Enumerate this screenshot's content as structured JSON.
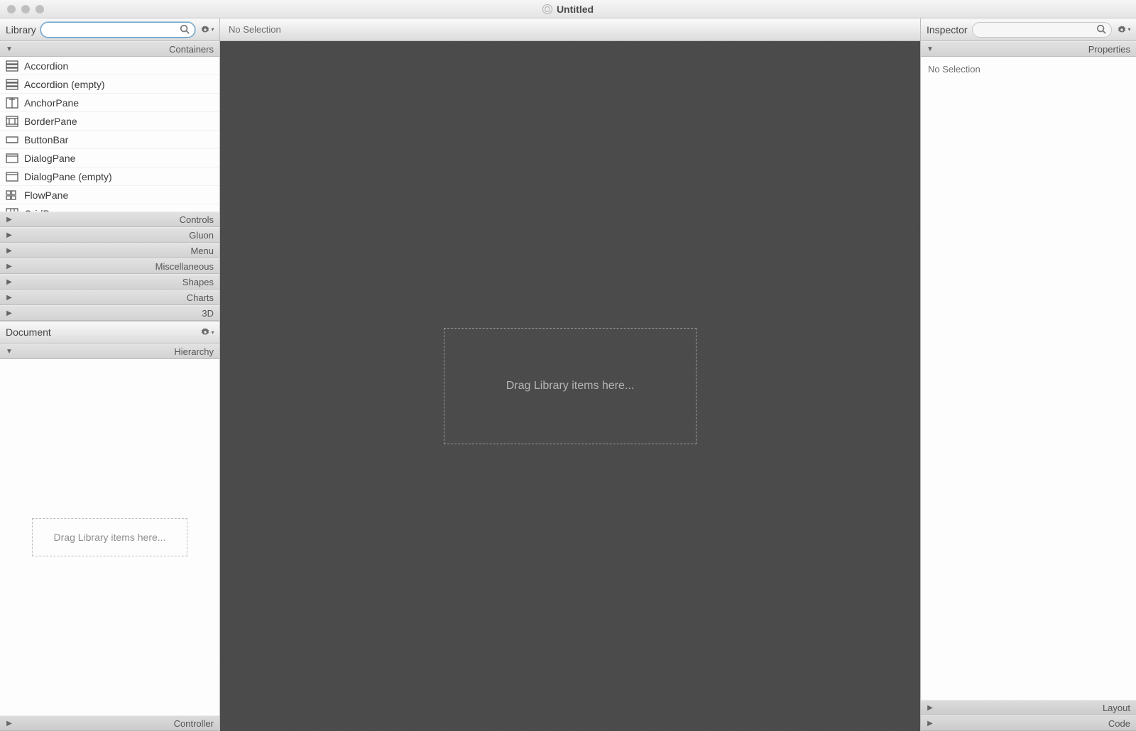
{
  "window": {
    "title": "Untitled"
  },
  "library": {
    "title": "Library",
    "search_value": "",
    "sections": {
      "containers": "Containers",
      "controls": "Controls",
      "gluon": "Gluon",
      "menu": "Menu",
      "miscellaneous": "Miscellaneous",
      "shapes": "Shapes",
      "charts": "Charts",
      "threeD": "3D"
    },
    "containers_items": [
      {
        "label": "Accordion",
        "icon": "accordion"
      },
      {
        "label": "Accordion  (empty)",
        "icon": "accordion"
      },
      {
        "label": "AnchorPane",
        "icon": "anchorpane"
      },
      {
        "label": "BorderPane",
        "icon": "borderpane"
      },
      {
        "label": "ButtonBar",
        "icon": "buttonbar"
      },
      {
        "label": "DialogPane",
        "icon": "dialogpane"
      },
      {
        "label": "DialogPane  (empty)",
        "icon": "dialogpane"
      },
      {
        "label": "FlowPane",
        "icon": "flowpane"
      },
      {
        "label": "GridPane",
        "icon": "gridpane"
      }
    ]
  },
  "document": {
    "title": "Document",
    "hierarchy_label": "Hierarchy",
    "controller_label": "Controller",
    "drop_hint": "Drag Library items here..."
  },
  "center": {
    "status": "No Selection",
    "drop_hint": "Drag Library items here..."
  },
  "inspector": {
    "title": "Inspector",
    "search_value": "",
    "sections": {
      "properties": "Properties",
      "layout": "Layout",
      "code": "Code"
    },
    "empty_text": "No Selection"
  }
}
